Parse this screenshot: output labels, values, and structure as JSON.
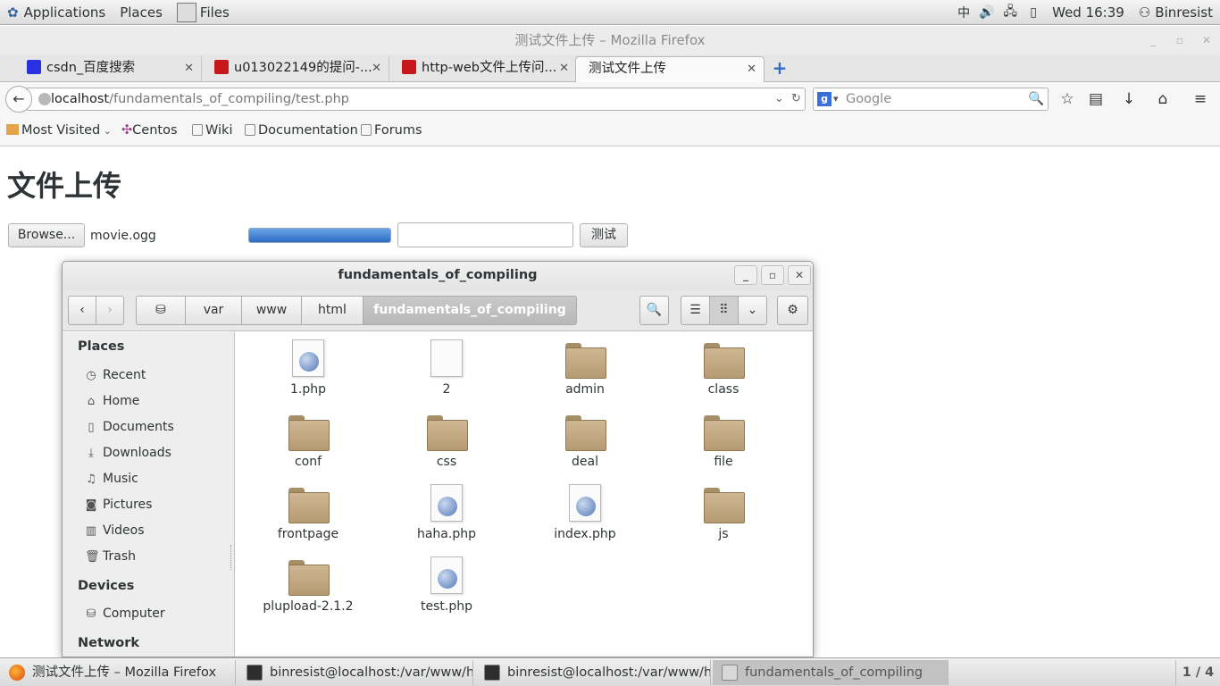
{
  "panel": {
    "applications": "Applications",
    "places": "Places",
    "files": "Files",
    "ime": "中",
    "clock": "Wed 16:39",
    "user": "Binresist"
  },
  "firefox": {
    "title": "测试文件上传 – Mozilla Firefox",
    "tabs": [
      {
        "label": "csdn_百度搜索"
      },
      {
        "label": "u013022149的提问-..."
      },
      {
        "label": "http-web文件上传问..."
      },
      {
        "label": "测试文件上传"
      }
    ],
    "url_host": "localhost",
    "url_path": "/fundamentals_of_compiling/test.php",
    "search_placeholder": "Google",
    "search_engine_glyph": "g",
    "bookmarks": [
      "Most Visited",
      "Centos",
      "Wiki",
      "Documentation",
      "Forums"
    ]
  },
  "page": {
    "heading": "文件上传",
    "browse_label": "Browse...",
    "file_name": "movie.ogg",
    "upload_progress": 1.0,
    "test_button": "测试"
  },
  "files_window": {
    "title": "fundamentals_of_compiling",
    "breadcrumbs": [
      "var",
      "www",
      "html",
      "fundamentals_of_compiling"
    ],
    "sidebar": {
      "places_heading": "Places",
      "places": [
        "Recent",
        "Home",
        "Documents",
        "Downloads",
        "Music",
        "Pictures",
        "Videos",
        "Trash"
      ],
      "devices_heading": "Devices",
      "devices": [
        "Computer"
      ],
      "network_heading": "Network"
    },
    "items": [
      {
        "name": "1.php",
        "type": "php"
      },
      {
        "name": "2",
        "type": "file"
      },
      {
        "name": "admin",
        "type": "folder"
      },
      {
        "name": "class",
        "type": "folder"
      },
      {
        "name": "conf",
        "type": "folder"
      },
      {
        "name": "css",
        "type": "folder"
      },
      {
        "name": "deal",
        "type": "folder"
      },
      {
        "name": "file",
        "type": "folder"
      },
      {
        "name": "frontpage",
        "type": "folder"
      },
      {
        "name": "haha.php",
        "type": "php"
      },
      {
        "name": "index.php",
        "type": "php"
      },
      {
        "name": "js",
        "type": "folder"
      },
      {
        "name": "plupload-2.1.2",
        "type": "folder"
      },
      {
        "name": "test.php",
        "type": "php"
      }
    ]
  },
  "taskbar": {
    "tasks": [
      "测试文件上传 – Mozilla Firefox",
      "binresist@localhost:/var/www/h...",
      "binresist@localhost:/var/www/h...",
      "fundamentals_of_compiling"
    ],
    "workspace": "1 / 4"
  },
  "colors": {
    "accent": "#2d6cc0",
    "panel_bg": "#e6e6e6",
    "folder": "#c2a983"
  }
}
